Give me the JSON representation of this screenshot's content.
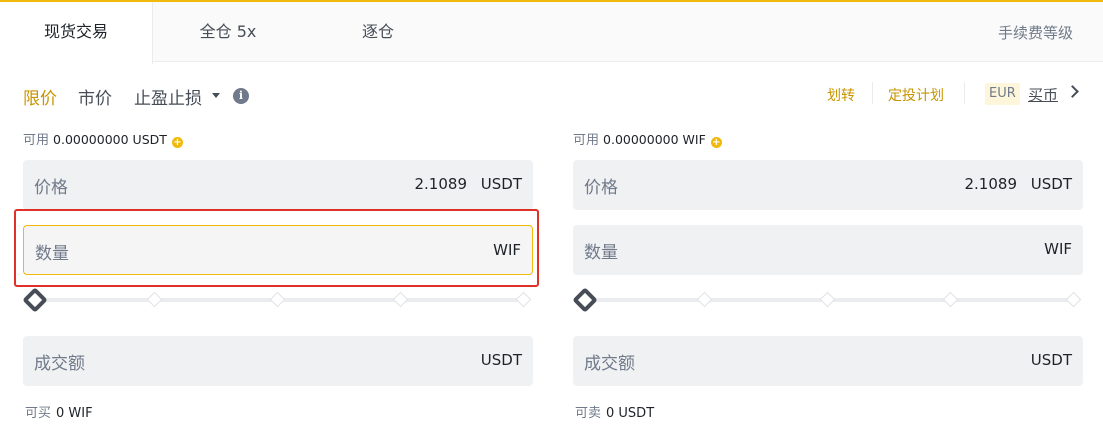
{
  "tabs": {
    "spot": "现货交易",
    "cross": "全仓 5x",
    "isolated": "逐仓",
    "fee_level": "手续费等级"
  },
  "order_types": {
    "limit": "限价",
    "market": "市价",
    "stop": "止盈止损"
  },
  "right_links": {
    "transfer": "划转",
    "plan": "定投计划",
    "currency": "EUR",
    "buy_crypto": "买币"
  },
  "buy": {
    "available_label": "可用",
    "available_value": "0.00000000 USDT",
    "price_label": "价格",
    "price_value": "2.1089",
    "price_unit": "USDT",
    "qty_label": "数量",
    "qty_unit": "WIF",
    "total_label": "成交额",
    "total_unit": "USDT",
    "max_label": "可买",
    "max_value": "0 WIF"
  },
  "sell": {
    "available_label": "可用",
    "available_value": "0.00000000 WIF",
    "price_label": "价格",
    "price_value": "2.1089",
    "price_unit": "USDT",
    "qty_label": "数量",
    "qty_unit": "WIF",
    "total_label": "成交额",
    "total_unit": "USDT",
    "max_label": "可卖",
    "max_value": "0 USDT"
  },
  "colors": {
    "accent": "#f0b90b",
    "accent_text": "#c99400",
    "highlight_box": "#e0302a",
    "field_bg": "#f0f1f2"
  },
  "icons": {
    "info": "info-icon",
    "add": "plus-circle-icon",
    "dropdown": "caret-down-icon",
    "next": "chevron-right-icon"
  }
}
